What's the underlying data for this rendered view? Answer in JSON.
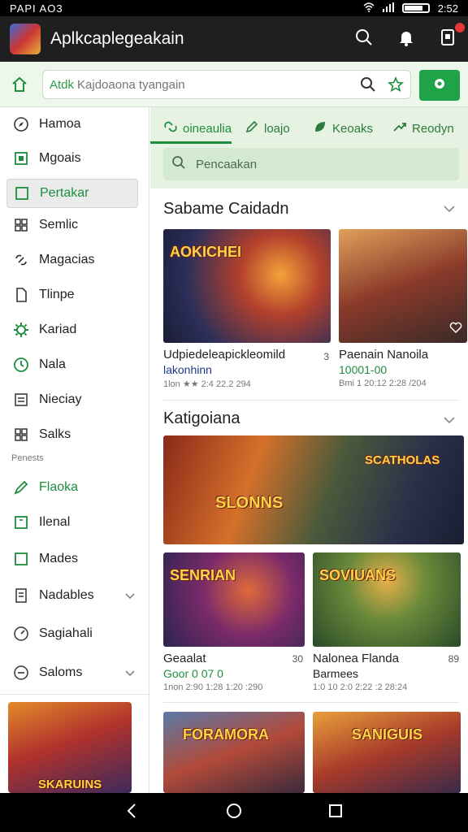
{
  "status_bar": {
    "left_text": "PAPI AO3",
    "time": "2:52"
  },
  "app": {
    "title": "Aplkcaplegeakain"
  },
  "search": {
    "prefix": "Atdk",
    "placeholder": "Kajdoaona tyangain"
  },
  "sidebar": {
    "items": [
      {
        "label": "Hamoa",
        "icon": "compass-icon"
      },
      {
        "label": "Mgoais",
        "icon": "square-icon"
      },
      {
        "label": "Pertakar",
        "icon": "square-icon"
      },
      {
        "label": "Semlic",
        "icon": "grid-icon"
      },
      {
        "label": "Magacias",
        "icon": "link-icon"
      },
      {
        "label": "Tlinpe",
        "icon": "file-icon"
      },
      {
        "label": "Kariad",
        "icon": "gear-icon"
      },
      {
        "label": "Nala",
        "icon": "clock-icon"
      },
      {
        "label": "Nieciay",
        "icon": "list-icon"
      },
      {
        "label": "Salks",
        "icon": "grid-icon"
      }
    ],
    "section_label": "Penests",
    "items2": [
      {
        "label": "Flaoka",
        "icon": "pen-icon"
      },
      {
        "label": "Ilenal",
        "icon": "square-icon"
      },
      {
        "label": "Mades",
        "icon": "square-icon"
      },
      {
        "label": "Nadables",
        "icon": "list-icon"
      },
      {
        "label": "Sagiahali",
        "icon": "gauge-icon"
      },
      {
        "label": "Saloms",
        "icon": "gauge-icon"
      }
    ],
    "banner_text": "SKARUINS"
  },
  "tabs": [
    {
      "label": "oineaulia"
    },
    {
      "label": "loajo"
    },
    {
      "label": "Keoaks"
    },
    {
      "label": "Reodyn"
    }
  ],
  "sub_search": {
    "label": "Pencaakan"
  },
  "section1": {
    "title": "Sabame Caidadn",
    "cards": [
      {
        "logo": "AOKICHEI",
        "name": "Udpiedeleapickleomild",
        "sub": "lakonhinn",
        "meta": "1lon ★★ 2:4 22.2 294",
        "size": "3"
      },
      {
        "logo": "",
        "name": "Paenain Nanoila",
        "sub": "10001-00",
        "meta": "Bmi 1 20:12 2:28 /204",
        "size": ""
      }
    ]
  },
  "section2": {
    "title": "Katigoiana",
    "banner_logo": "SLONNS",
    "banner_logo2": "SCATHOLAS",
    "cards": [
      {
        "logo": "SENRIAN",
        "name": "Geaalat",
        "sub": "Goor 0 07 0",
        "meta": "1non 2:90 1:28 1:20 :290",
        "size": "30"
      },
      {
        "logo": "SOVIUANS",
        "name": "Nalonea Flanda",
        "sub": "Barmees",
        "meta": "1:0 10 2:0 2:22 :2 28:24",
        "size": "89"
      }
    ],
    "cards_row2": [
      {
        "logo": "FORAMORA"
      },
      {
        "logo": "SANIGUIS"
      }
    ]
  },
  "colors": {
    "accent": "#1e8e3e",
    "appbar": "#1f1f1f",
    "tint": "#e6f3e3"
  }
}
